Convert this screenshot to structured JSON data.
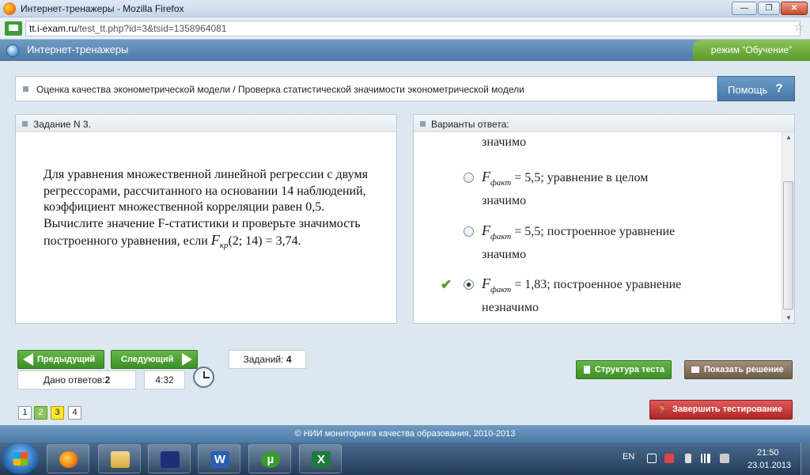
{
  "window": {
    "title": "Интернет-тренажеры - Mozilla Firefox",
    "minimize": "—",
    "maximize": "❐",
    "close": "✕"
  },
  "address": {
    "domain": "tt.i-exam.ru",
    "path": "/test_tt.php?id=3&tsid=1358964081"
  },
  "app": {
    "name": "Интернет-тренажеры",
    "mode": "режим “Обучение”"
  },
  "breadcrumb": "Оценка качества эконометрической модели / Проверка статистической значимости эконометрической модели",
  "help": {
    "label": "Помощь",
    "icon": "?"
  },
  "task": {
    "header": "Задание N 3.",
    "text_before": "Для уравнения множественной линейной регрессии с двумя регрессорами, рассчитанного на основании 14 наблюдений, коэффициент множественной корреляции равен 0,5. Вычислите значение F-статистики и проверьте значимость построенного уравнения, если ",
    "formula_var": "F",
    "formula_sub": "кр",
    "formula_args": "(2; 14) = 3,74."
  },
  "answers": {
    "header": "Варианты ответа:",
    "options": [
      {
        "line2": "значимо"
      },
      {
        "var": "F",
        "sub": "факт",
        "value": " = 5,5",
        "text": "; уравнение в целом",
        "line2": "значимо",
        "selected": false
      },
      {
        "var": "F",
        "sub": "факт",
        "value": " = 5,5",
        "text": "; построенное уравнение",
        "line2": "значимо",
        "selected": false
      },
      {
        "var": "F",
        "sub": "факт",
        "value": " = 1,83",
        "text": "; построенное уравнение",
        "line2": "незначимо",
        "selected": true,
        "correct": true
      }
    ]
  },
  "controls": {
    "prev": "Предыдущий",
    "next": "Следующий",
    "answered_label": "Дано ответов:",
    "answered_count": "2",
    "timer": "4:32",
    "tasks_label": "Заданий:",
    "tasks_count": "4",
    "pages": [
      "1",
      "2",
      "3",
      "4"
    ],
    "structure": "Структура теста",
    "solution": "Показать решение",
    "finish": "Завершить тестирование"
  },
  "footer": "© НИИ мониторинга качества образования, 2010-2013",
  "taskbar": {
    "lang": "EN",
    "time": "21:50",
    "date": "23.01.2013",
    "apps": {
      "word": "W",
      "utorrent": "µ",
      "excel": "X"
    }
  },
  "colors": {
    "header_blue": "#4d7aa6",
    "green": "#3c8f25",
    "red": "#b22424",
    "brown": "#6c5c47"
  }
}
